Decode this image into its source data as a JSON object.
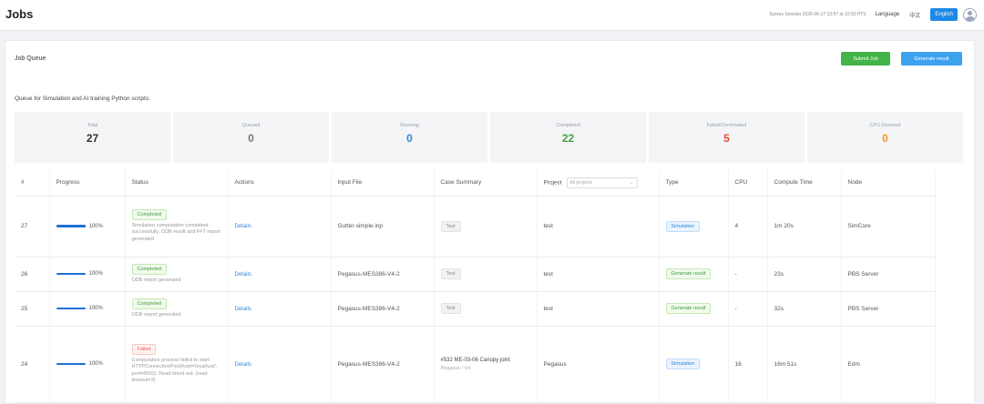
{
  "header": {
    "title": "Jobs",
    "survey_text": "Survey Session 2026-06-17 13:57 at 10:30 PTS",
    "language_label": "Language",
    "lang_options": [
      "中文",
      "English"
    ],
    "active_lang": "English"
  },
  "panel": {
    "title": "Job Queue",
    "submit_label": "Submit Job",
    "generate_label": "Generate result",
    "queue_desc": "Queue for Simulation and AI training Python scripts:"
  },
  "stats": [
    {
      "label": "Total",
      "value": "27",
      "color": "#333333"
    },
    {
      "label": "Queued",
      "value": "0",
      "color": "#777777"
    },
    {
      "label": "Running",
      "value": "0",
      "color": "#2f86d9"
    },
    {
      "label": "Completed",
      "value": "22",
      "color": "#43a047"
    },
    {
      "label": "Failed/Terminated",
      "value": "5",
      "color": "#e64a3c"
    },
    {
      "label": "CPU Demand",
      "value": "0",
      "color": "#f59a23"
    }
  ],
  "table": {
    "columns": [
      "#",
      "Progress",
      "Status",
      "Actions",
      "Input File",
      "Case Summary",
      "Project",
      "Type",
      "CPU",
      "Compute Time",
      "Node"
    ],
    "project_filter_placeholder": "All projects",
    "rows": [
      {
        "id": "27",
        "progress": 1.0,
        "progress_label": "100%",
        "status": "Completed",
        "status_kind": "completed",
        "status_msg": "Simulation computation completed successfully, ODB result and FFT report generated",
        "action": "Details",
        "input_file": "Gutter-simple.inp",
        "case_tag": "Test",
        "case_title": "",
        "case_sub": "",
        "project": "test",
        "type": "Simulation",
        "type_kind": "sim",
        "cpu": "4",
        "compute_time": "1m 20s",
        "node": "SimCore"
      },
      {
        "id": "26",
        "progress": 1.0,
        "progress_label": "100%",
        "status": "Completed",
        "status_kind": "completed",
        "status_msg": "ODB report generated",
        "action": "Details",
        "input_file": "Pegasus-MES386-V4-2",
        "case_tag": "Test",
        "case_title": "",
        "case_sub": "",
        "project": "test",
        "type": "Generate result",
        "type_kind": "gen",
        "cpu": "-",
        "compute_time": "23s",
        "node": "PBS Server"
      },
      {
        "id": "25",
        "progress": 1.0,
        "progress_label": "100%",
        "status": "Completed",
        "status_kind": "completed",
        "status_msg": "ODB report generated",
        "action": "Details",
        "input_file": "Pegasus-MES386-V4-2",
        "case_tag": "Test",
        "case_title": "",
        "case_sub": "",
        "project": "test",
        "type": "Generate result",
        "type_kind": "gen",
        "cpu": "-",
        "compute_time": "32s",
        "node": "PBS Server"
      },
      {
        "id": "24",
        "progress": 1.0,
        "progress_label": "100%",
        "status": "Failed",
        "status_kind": "failed",
        "status_msg": "Computation process failed to start: HTTPConnectionPool(host='localhost', port=8000): Read timed out. (read timeout=3)",
        "action": "Details",
        "input_file": "Pegasus-MES386-V4-2",
        "case_tag": "",
        "case_title": "#532 ME-03-06 Canopy joint",
        "case_sub": "Pegasus / V4",
        "project": "Pegasus",
        "type": "Simulation",
        "type_kind": "sim",
        "cpu": "16",
        "compute_time": "16m 51s",
        "node": "Edm"
      }
    ]
  }
}
